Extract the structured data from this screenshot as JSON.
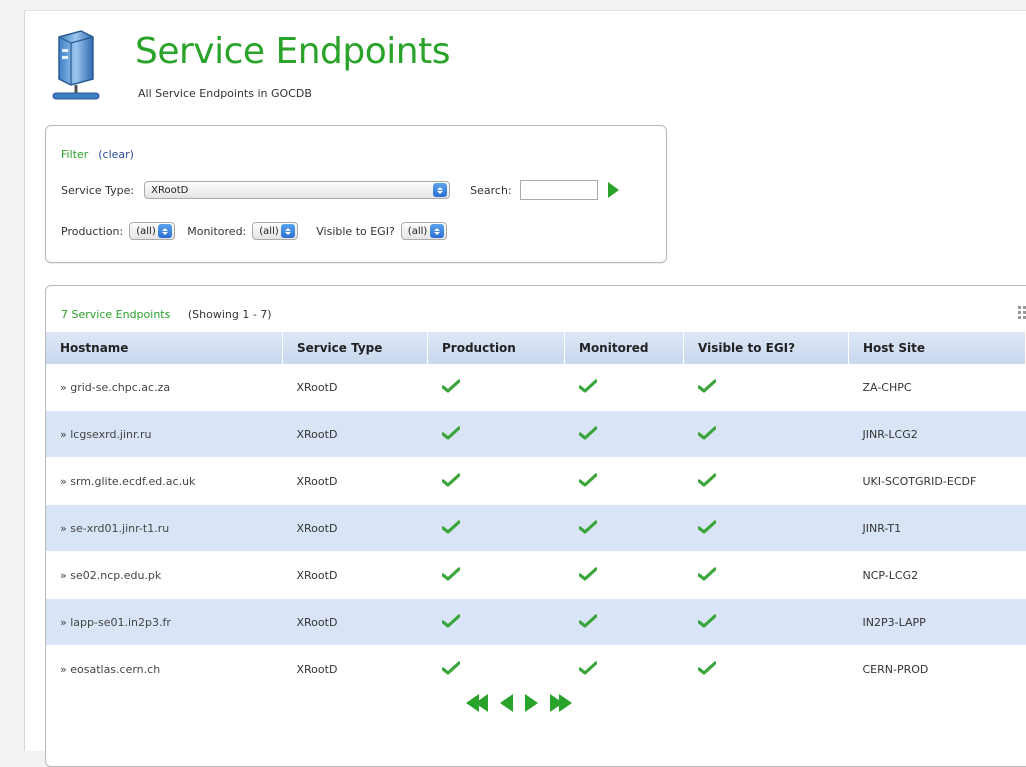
{
  "header": {
    "title": "Service Endpoints",
    "subtitle": "All Service Endpoints in GOCDB",
    "icon": "server-icon"
  },
  "filter": {
    "label": "Filter",
    "clear": "(clear)",
    "service_type_label": "Service Type:",
    "service_type_value": "XRootD",
    "search_label": "Search:",
    "search_value": "",
    "production_label": "Production:",
    "production_value": "(all)",
    "monitored_label": "Monitored:",
    "monitored_value": "(all)",
    "visible_label": "Visible to EGI?",
    "visible_value": "(all)"
  },
  "results": {
    "count": "7 Service Endpoints",
    "showing": "(Showing 1 - 7)",
    "columns": [
      "Hostname",
      "Service Type",
      "Production",
      "Monitored",
      "Visible to EGI?",
      "Host Site"
    ],
    "rows": [
      {
        "hostname": "» grid-se.chpc.ac.za",
        "service_type": "XRootD",
        "production": true,
        "monitored": true,
        "visible": true,
        "site": "ZA-CHPC"
      },
      {
        "hostname": "» lcgsexrd.jinr.ru",
        "service_type": "XRootD",
        "production": true,
        "monitored": true,
        "visible": true,
        "site": "JINR-LCG2"
      },
      {
        "hostname": "» srm.glite.ecdf.ed.ac.uk",
        "service_type": "XRootD",
        "production": true,
        "monitored": true,
        "visible": true,
        "site": "UKI-SCOTGRID-ECDF"
      },
      {
        "hostname": "» se-xrd01.jinr-t1.ru",
        "service_type": "XRootD",
        "production": true,
        "monitored": true,
        "visible": true,
        "site": "JINR-T1"
      },
      {
        "hostname": "» se02.ncp.edu.pk",
        "service_type": "XRootD",
        "production": true,
        "monitored": true,
        "visible": true,
        "site": "NCP-LCG2"
      },
      {
        "hostname": "» lapp-se01.in2p3.fr",
        "service_type": "XRootD",
        "production": true,
        "monitored": true,
        "visible": true,
        "site": "IN2P3-LAPP"
      },
      {
        "hostname": "» eosatlas.cern.ch",
        "service_type": "XRootD",
        "production": true,
        "monitored": true,
        "visible": true,
        "site": "CERN-PROD"
      }
    ]
  },
  "pager": [
    "first-page-icon",
    "previous-page-icon",
    "next-page-icon",
    "last-page-icon"
  ],
  "colors": {
    "accent_green": "#2aa32a",
    "row_blue": "#d9e5f7",
    "header_blue": "#c9d8ee"
  }
}
